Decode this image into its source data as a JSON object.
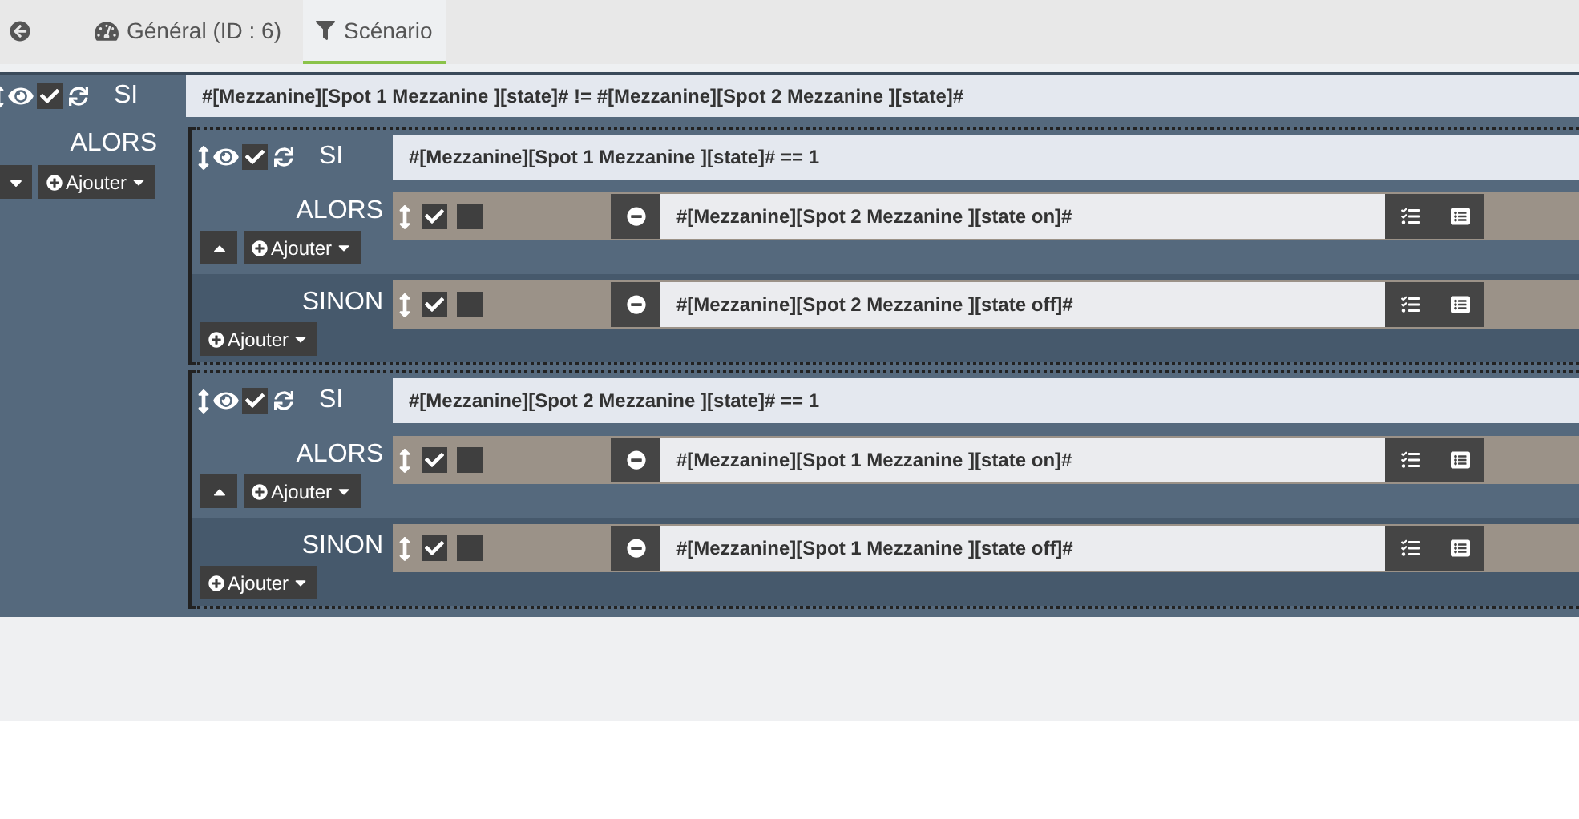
{
  "tabs": [
    {
      "kind": "back",
      "selected": false
    },
    {
      "kind": "gauge",
      "label": "Général (ID : 6)",
      "selected": false
    },
    {
      "kind": "filter",
      "label": "Scénario",
      "selected": true
    }
  ],
  "scenario": {
    "si_label": "SI",
    "enabled": true,
    "condition": "#[Mezzanine][Spot 1 Mezzanine ][state]# != #[Mezzanine][Spot 2 Mezzanine ][state]#",
    "alors_label": "ALORS",
    "add_button": "Ajouter",
    "blocks": [
      {
        "si_label": "SI",
        "enabled": true,
        "condition": "#[Mezzanine][Spot 1 Mezzanine ][state]# == 1",
        "alors_label": "ALORS",
        "alors_add": "Ajouter",
        "alors_actions": [
          {
            "enabled": true,
            "option": false,
            "command": "#[Mezzanine][Spot 2 Mezzanine ][state on]#"
          }
        ],
        "sinon_label": "SINON",
        "sinon_add": "Ajouter",
        "sinon_actions": [
          {
            "enabled": true,
            "option": false,
            "command": "#[Mezzanine][Spot 2 Mezzanine ][state off]#"
          }
        ]
      },
      {
        "si_label": "SI",
        "enabled": true,
        "condition": "#[Mezzanine][Spot 2 Mezzanine ][state]# == 1",
        "alors_label": "ALORS",
        "alors_add": "Ajouter",
        "alors_actions": [
          {
            "enabled": true,
            "option": false,
            "command": "#[Mezzanine][Spot 1 Mezzanine ][state on]#"
          }
        ],
        "sinon_label": "SINON",
        "sinon_add": "Ajouter",
        "sinon_actions": [
          {
            "enabled": true,
            "option": false,
            "command": "#[Mezzanine][Spot 1 Mezzanine ][state off]#"
          }
        ]
      }
    ]
  }
}
